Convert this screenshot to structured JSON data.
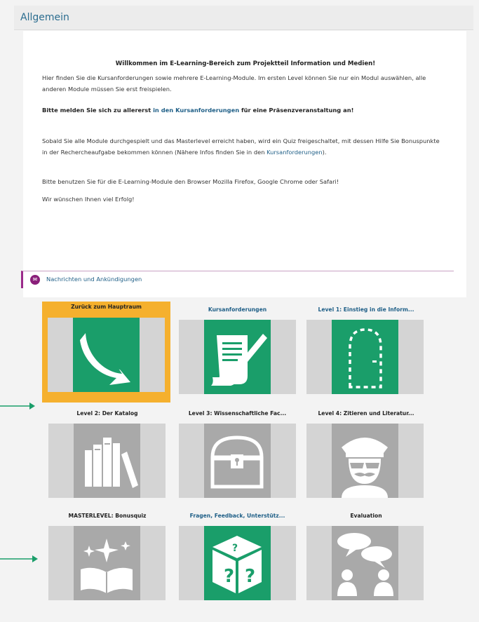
{
  "section": {
    "title": "Allgemein"
  },
  "intro": {
    "welcome": "Willkommen im E-Learning-Bereich zum Projektteil Information und Medien!",
    "p1": "Hier finden Sie die Kursanforderungen sowie mehrere E-Learning-Module. Im ersten Level können Sie nur ein Modul auswählen, alle anderen Module müssen Sie erst freispielen.",
    "p2_prefix": "Bitte melden Sie sich zu allererst ",
    "p2_link": "in den Kursanforderungen",
    "p2_suffix": " für eine Präsenzveranstaltung an!",
    "p3_text": "Sobald Sie alle Module durchgespielt und das Masterlevel erreicht haben, wird ein Quiz freigeschaltet, mit dessen Hilfe Sie Bonuspunkte in der Rechercheaufgabe bekommen können (Nähere Infos finden Sie in den ",
    "p3_link": "Kursanforderungen",
    "p3_suffix": ").",
    "p4": "Bitte benutzen Sie für die E-Learning-Module den Browser Mozilla Firefox, Google Chrome oder Safari!",
    "p5": "Wir wünschen Ihnen viel Erfolg!"
  },
  "announcements": {
    "label": "Nachrichten und Ankündigungen",
    "icon": "mail-icon"
  },
  "tiles": [
    {
      "title": "Zurück zum Hauptraum",
      "icon": "arrow-back-icon",
      "style": "orange",
      "locked": false
    },
    {
      "title": "Kursanforderungen",
      "icon": "document-quill-icon",
      "style": "green",
      "locked": false
    },
    {
      "title": "Level 1: Einstieg in die Inform...",
      "icon": "door-icon",
      "style": "green",
      "locked": false
    },
    {
      "title": "Level 2: Der Katalog",
      "icon": "books-icon",
      "style": "gray",
      "locked": true
    },
    {
      "title": "Level 3: Wissenschaftliche Fac...",
      "icon": "treasure-chest-icon",
      "style": "gray",
      "locked": true
    },
    {
      "title": "Level 4: Zitieren und Literatur...",
      "icon": "police-officer-icon",
      "style": "gray",
      "locked": true
    },
    {
      "title": "MASTERLEVEL: Bonusquiz",
      "icon": "magic-book-icon",
      "style": "gray",
      "locked": true
    },
    {
      "title": "Fragen, Feedback, Unterstütz...",
      "icon": "question-dice-icon",
      "style": "green",
      "locked": false
    },
    {
      "title": "Evaluation",
      "icon": "speech-bubbles-people-icon",
      "style": "gray",
      "locked": true
    }
  ],
  "colors": {
    "green": "#1a9e6a",
    "orange": "#f5b02e",
    "link": "#1f5f87",
    "gray": "#a9a9a9"
  }
}
